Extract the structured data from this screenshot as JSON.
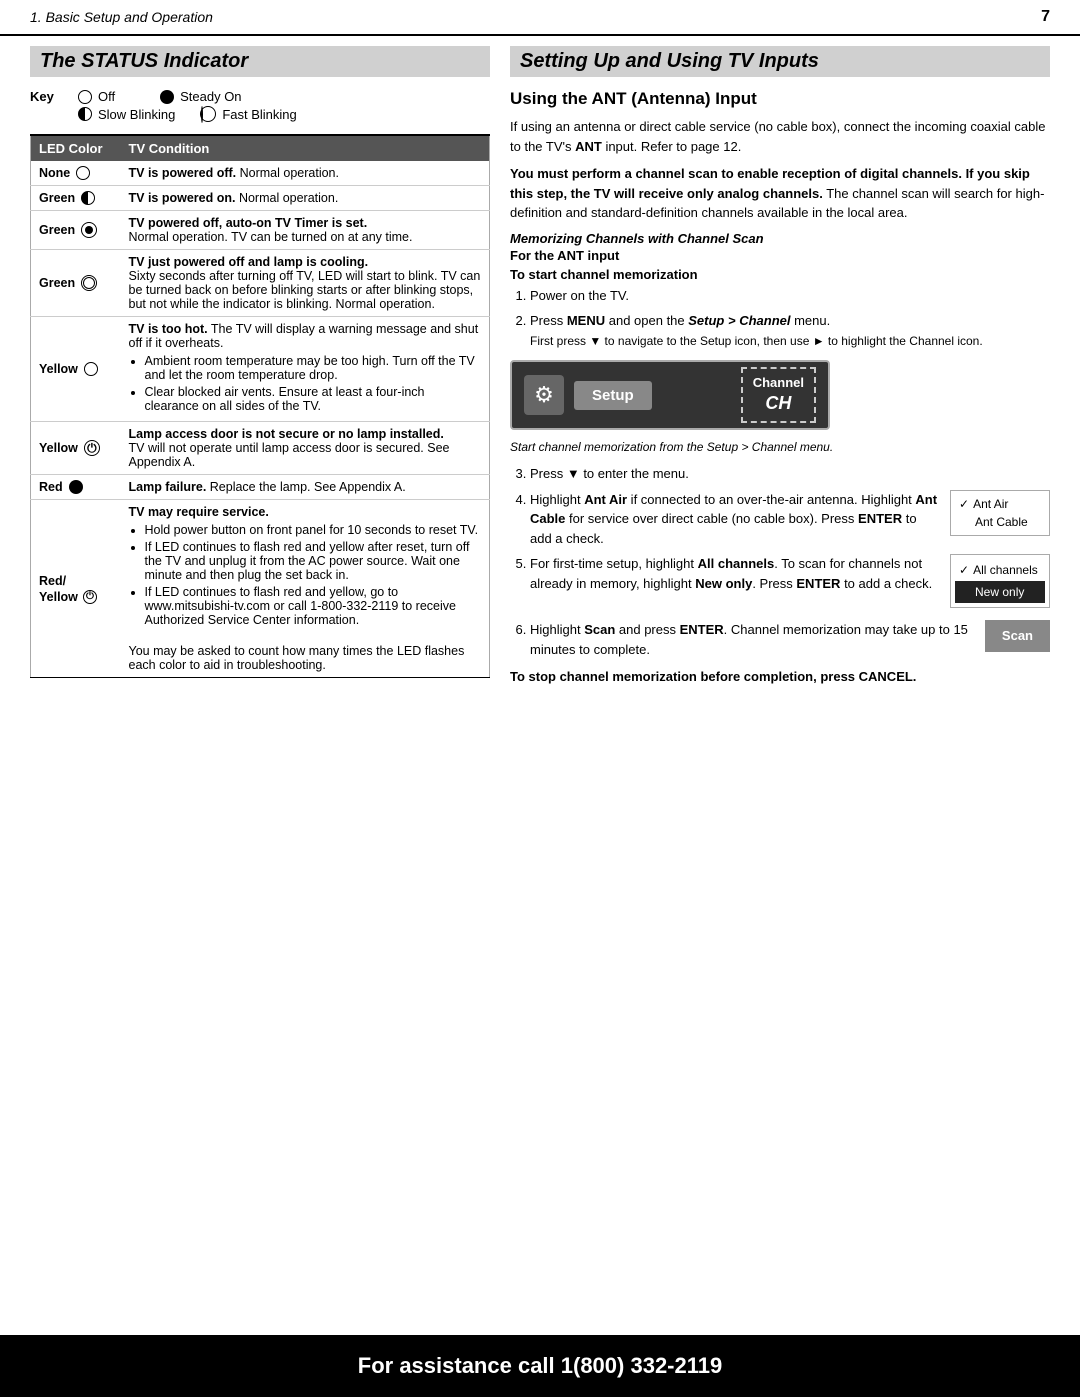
{
  "header": {
    "title": "1.  Basic Setup and Operation",
    "page_number": "7"
  },
  "left_section": {
    "title": "The STATUS Indicator",
    "key_label": "Key",
    "legend": [
      {
        "symbol": "empty",
        "label": "Off"
      },
      {
        "symbol": "full",
        "label": "Steady On"
      },
      {
        "symbol": "half",
        "label": "Slow Blinking"
      },
      {
        "symbol": "double",
        "label": "Fast Blinking"
      }
    ],
    "table_headers": [
      "LED Color",
      "TV Condition"
    ],
    "rows": [
      {
        "color": "None",
        "indicator": "empty",
        "condition": "TV is powered off. Normal operation."
      },
      {
        "color": "Green",
        "indicator": "half",
        "condition": "TV is powered on. Normal operation."
      },
      {
        "color": "Green",
        "indicator": "empty_circle_power",
        "condition": "TV powered off, auto-on TV Timer is set.",
        "extra": "Normal operation. TV can be turned on at any time."
      },
      {
        "color": "Green",
        "indicator": "double",
        "condition_bold": "TV just powered off and lamp is cooling.",
        "extra": "Sixty seconds after turning off TV, LED will start to blink. TV can be turned back on before blinking starts or after blinking stops, but not while the indicator is blinking. Normal operation."
      },
      {
        "color": "Yellow",
        "indicator": "empty",
        "condition_bold": "TV is too hot.",
        "condition_extra": " The TV will display a warning message and shut off if it overheats.",
        "bullets": [
          "Ambient room temperature may be too high. Turn off the TV and let the room temperature drop.",
          "Clear blocked air vents. Ensure at least a four-inch clearance on all sides of the TV."
        ]
      },
      {
        "color": "Yellow",
        "indicator": "power_icon",
        "condition_bold": "Lamp access door is not secure or no lamp installed.",
        "extra": "TV will not operate until lamp access door is secured. See Appendix A."
      },
      {
        "color": "Red",
        "indicator": "full",
        "condition_bold": "Lamp failure.",
        "condition_extra": " Replace the lamp. See Appendix A."
      },
      {
        "color": "Red/ Yellow",
        "indicator": "power_both",
        "condition_bold": "TV may require service.",
        "bullets": [
          "Hold power button on front panel for 10 seconds to reset TV.",
          "If LED continues to flash red and yellow after reset, turn off the TV and unplug it from the AC power source. Wait one minute and then plug the set back in.",
          "If LED continues to flash red and yellow, go to www.mitsubishi-tv.com or call 1-800-332-2119 to receive Authorized Service Center information."
        ],
        "extra2": "You may be asked to count how many times the LED flashes each color to aid in troubleshooting."
      }
    ]
  },
  "right_section": {
    "title": "Setting Up and Using TV Inputs",
    "subsection_title": "Using the ANT (Antenna) Input",
    "intro": "If using an antenna or direct cable service (no cable box), connect the incoming coaxial cable to the TV's ANT input. Refer to page 12.",
    "warning": "You must perform a channel scan to enable reception of digital channels. If you skip this step, the TV will receive only analog channels. The channel scan will search for high-definition and standard-definition channels available in the local area.",
    "memorizing_heading": "Memorizing Channels with Channel Scan",
    "for_ant_heading": "For the ANT input",
    "to_start_heading": "To start channel memorization",
    "steps": [
      {
        "num": "1.",
        "text": "Power on the TV."
      },
      {
        "num": "2.",
        "text": "Press MENU and open the ",
        "bold": "Setup > Channel",
        "text2": " menu.",
        "sub": "First press ▼ to navigate to the Setup icon, then use ► to highlight the Channel icon."
      },
      {
        "num": "3.",
        "text": "Press ▼ to enter the menu."
      },
      {
        "num": "4.",
        "text": "Highlight ",
        "bold": "Ant Air",
        "text2": " if connected to an over-the-air antenna. Highlight ",
        "bold2": "Ant Cable",
        "text3": " for service over direct cable (no cable box). Press ",
        "bold3": "ENTER",
        "text4": " to add a check.",
        "panel": "ant"
      },
      {
        "num": "5.",
        "text": "For first-time setup, highlight ",
        "bold": "All channels",
        "text2": ". To scan for channels not already in memory, highlight ",
        "bold2": "New only",
        "text3": ". Press ",
        "bold3": "ENTER",
        "text4": " to add a check.",
        "panel": "channels"
      },
      {
        "num": "6.",
        "text": "Highlight ",
        "bold": "Scan",
        "text2": " and press ",
        "bold2": "ENTER",
        "text3": ". Channel memorization may take up to 15 minutes to complete.",
        "panel": "scan"
      }
    ],
    "setup_image": {
      "gear_icon": "⚙",
      "setup_label": "Setup",
      "channel_label": "Channel\nCH"
    },
    "setup_caption": "Start channel memorization from the Setup > Channel menu.",
    "ant_panel": {
      "items": [
        {
          "checked": true,
          "label": "Ant Air"
        },
        {
          "checked": false,
          "label": "Ant Cable"
        }
      ]
    },
    "channels_panel": {
      "items": [
        {
          "checked": true,
          "label": "All channels",
          "highlighted": false
        },
        {
          "checked": false,
          "label": "New only",
          "highlighted": true
        }
      ]
    },
    "scan_panel": {
      "label": "Scan"
    },
    "stop_text": "To stop channel memorization before completion, press CANCEL."
  },
  "footer": {
    "text": "For assistance call 1(800) 332-2119"
  }
}
